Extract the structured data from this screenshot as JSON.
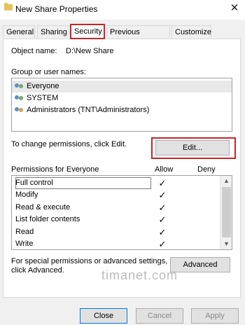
{
  "window": {
    "title": "New Share Properties",
    "close_glyph": "✕"
  },
  "tabs": [
    {
      "label": "General",
      "active": false
    },
    {
      "label": "Sharing",
      "active": false
    },
    {
      "label": "Security",
      "active": true
    },
    {
      "label": "Previous Versions",
      "active": false
    },
    {
      "label": "Customize",
      "active": false
    }
  ],
  "object": {
    "label": "Object name:",
    "value": "D:\\New Share"
  },
  "groups": {
    "label": "Group or user names:",
    "items": [
      {
        "name": "Everyone",
        "icon": "users-icon",
        "selected": true
      },
      {
        "name": "SYSTEM",
        "icon": "users-icon",
        "selected": false
      },
      {
        "name": "Administrators (TNT\\Administrators)",
        "icon": "users-icon",
        "selected": false
      }
    ]
  },
  "change_text": "To change permissions, click Edit.",
  "edit_button": "Edit...",
  "permissions": {
    "header": "Permissions for Everyone",
    "allow_label": "Allow",
    "deny_label": "Deny",
    "rows": [
      {
        "name": "Full control",
        "allow": true,
        "deny": false,
        "focused": true
      },
      {
        "name": "Modify",
        "allow": true,
        "deny": false
      },
      {
        "name": "Read & execute",
        "allow": true,
        "deny": false
      },
      {
        "name": "List folder contents",
        "allow": true,
        "deny": false
      },
      {
        "name": "Read",
        "allow": true,
        "deny": false
      },
      {
        "name": "Write",
        "allow": true,
        "deny": false
      }
    ],
    "check_glyph": "✓"
  },
  "special": {
    "line1": "For special permissions or advanced settings,",
    "line2": "click Advanced.",
    "button": "Advanced"
  },
  "watermark": "timanet.com",
  "footer": {
    "close": "Close",
    "cancel": "Cancel",
    "apply": "Apply"
  },
  "colors": {
    "highlight_border": "#c1272d",
    "window_bg": "#f0f0f0"
  }
}
